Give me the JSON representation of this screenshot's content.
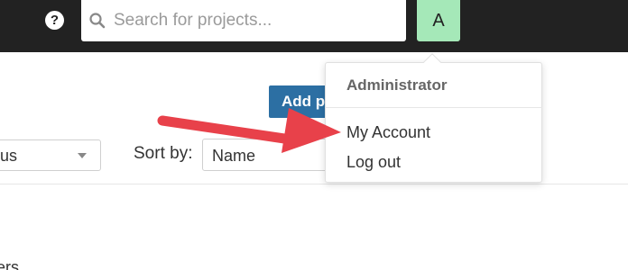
{
  "header": {
    "help_symbol": "?",
    "help_icon": "help-circle-icon",
    "search_placeholder": "Search for projects...",
    "search_icon": "search-icon",
    "avatar_initial": "A",
    "avatar_color": "#a5e8b8"
  },
  "toolbar": {
    "add_label": "Add p",
    "add_color": "#2c6fa3"
  },
  "filters": {
    "status_value": "us",
    "sort_label": "Sort by:",
    "sort_value": "Name"
  },
  "content": {
    "partial_text": "ers"
  },
  "user_menu": {
    "header": "Administrator",
    "items": [
      {
        "label": "My Account"
      },
      {
        "label": "Log out"
      }
    ]
  },
  "annotation": {
    "arrow_color": "#e8414a"
  }
}
